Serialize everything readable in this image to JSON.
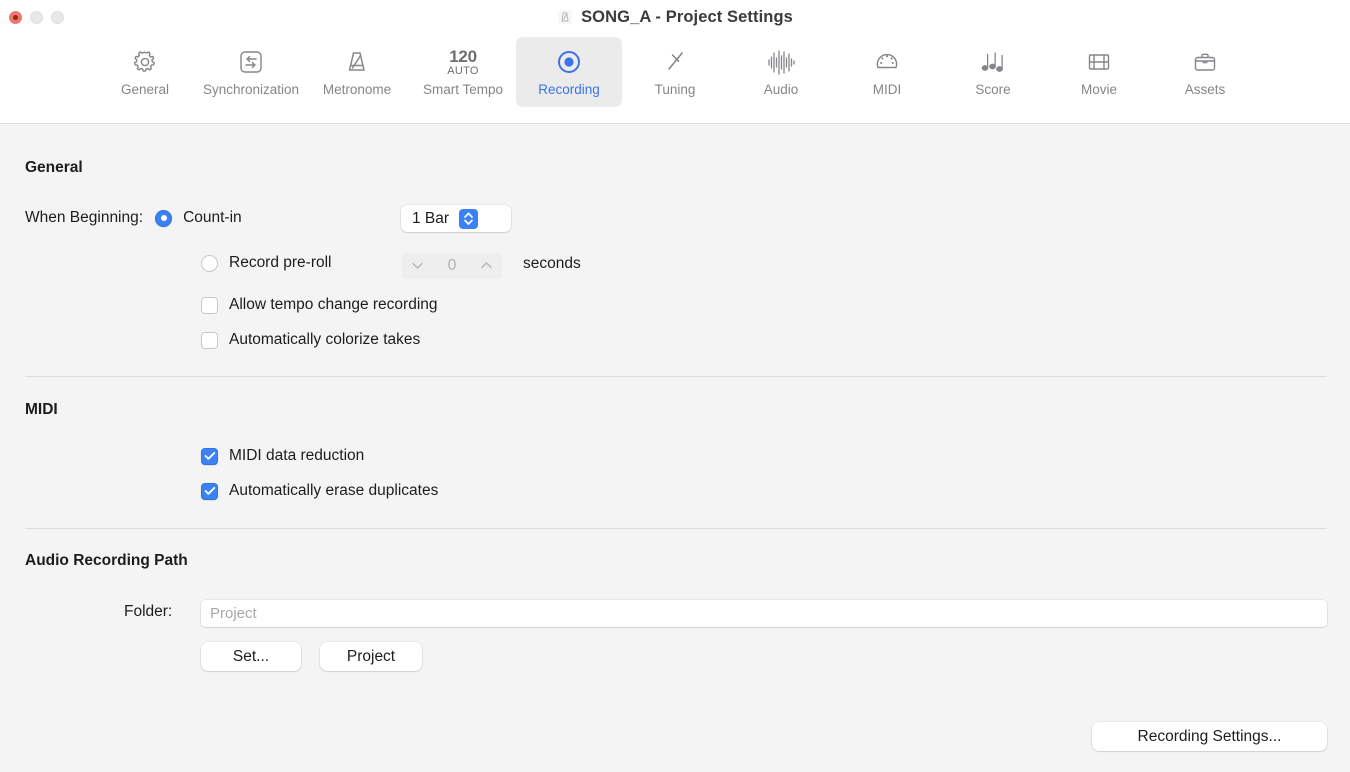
{
  "window": {
    "title": "SONG_A - Project Settings",
    "title_icon": "metronome-icon",
    "controls": {
      "close": "close-button",
      "minimize": "minimize-button",
      "maximize": "maximize-button"
    }
  },
  "toolbar": {
    "selected": "Recording",
    "accent_color": "#3b74e8",
    "selected_bg": "#ebebeb",
    "items": [
      {
        "label": "General",
        "icon": "gear-icon"
      },
      {
        "label": "Synchronization",
        "icon": "sync-arrows-icon"
      },
      {
        "label": "Metronome",
        "icon": "metronome-icon"
      },
      {
        "label": "Smart Tempo",
        "icon": "tempo-number-icon",
        "tempo_value": "120",
        "tempo_mode": "AUTO"
      },
      {
        "label": "Recording",
        "icon": "record-circle-icon"
      },
      {
        "label": "Tuning",
        "icon": "tuning-fork-icon"
      },
      {
        "label": "Audio",
        "icon": "waveform-icon"
      },
      {
        "label": "MIDI",
        "icon": "midi-connector-icon"
      },
      {
        "label": "Score",
        "icon": "music-notes-icon"
      },
      {
        "label": "Movie",
        "icon": "film-strip-icon"
      },
      {
        "label": "Assets",
        "icon": "briefcase-icon"
      }
    ]
  },
  "general": {
    "heading": "General",
    "when_beginning_label": "When Beginning:",
    "count_in": {
      "label": "Count-in",
      "selected": true,
      "popup_value": "1 Bar"
    },
    "pre_roll": {
      "label": "Record pre-roll",
      "selected": false,
      "value": "0",
      "unit": "seconds",
      "enabled": false
    },
    "checkboxes": [
      {
        "label": "Allow tempo change recording",
        "checked": false
      },
      {
        "label": "Automatically colorize takes",
        "checked": false
      }
    ]
  },
  "midi": {
    "heading": "MIDI",
    "checkboxes": [
      {
        "label": "MIDI data reduction",
        "checked": true
      },
      {
        "label": "Automatically erase duplicates",
        "checked": true
      }
    ]
  },
  "audio_path": {
    "heading": "Audio Recording Path",
    "folder_label": "Folder:",
    "folder_value": "",
    "folder_placeholder": "Project",
    "set_button": "Set...",
    "project_button": "Project"
  },
  "footer": {
    "recording_settings_button": "Recording Settings..."
  }
}
